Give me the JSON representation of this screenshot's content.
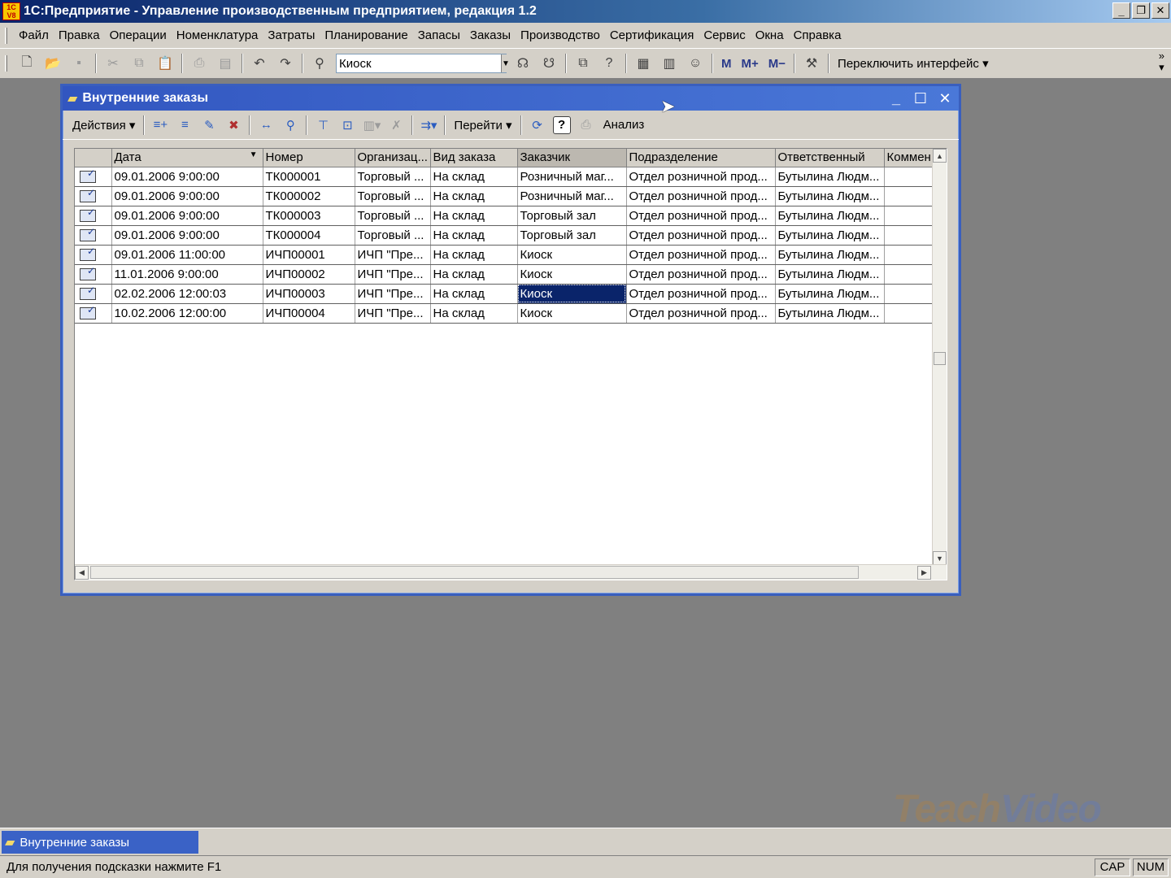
{
  "app": {
    "title": "1С:Предприятие - Управление производственным предприятием, редакция 1.2",
    "logo": "1С V8"
  },
  "menu": [
    "Файл",
    "Правка",
    "Операции",
    "Номенклатура",
    "Затраты",
    "Планирование",
    "Запасы",
    "Заказы",
    "Производство",
    "Сертификация",
    "Сервис",
    "Окна",
    "Справка"
  ],
  "toolbar": {
    "search_value": "Киоск",
    "switch_interface": "Переключить интерфейс ▾",
    "m": "M",
    "m_plus": "M+",
    "m_minus": "M−"
  },
  "child_window": {
    "title": "Внутренние заказы",
    "actions_label": "Действия ▾",
    "goto_label": "Перейти ▾",
    "analysis_label": "Анализ"
  },
  "grid": {
    "columns": [
      "",
      "Дата",
      "Номер",
      "Организац...",
      "Вид заказа",
      "Заказчик",
      "Подразделение",
      "Ответственный",
      "Коммен"
    ],
    "rows": [
      {
        "date": "09.01.2006 9:00:00",
        "number": "ТК000001",
        "org": "Торговый ...",
        "type": "На склад",
        "customer": "Розничный маг...",
        "dept": "Отдел розничной прод...",
        "resp": "Бутылина Людм..."
      },
      {
        "date": "09.01.2006 9:00:00",
        "number": "ТК000002",
        "org": "Торговый ...",
        "type": "На склад",
        "customer": "Розничный маг...",
        "dept": "Отдел розничной прод...",
        "resp": "Бутылина Людм..."
      },
      {
        "date": "09.01.2006 9:00:00",
        "number": "ТК000003",
        "org": "Торговый ...",
        "type": "На склад",
        "customer": "Торговый зал",
        "dept": "Отдел розничной прод...",
        "resp": "Бутылина Людм..."
      },
      {
        "date": "09.01.2006 9:00:00",
        "number": "ТК000004",
        "org": "Торговый ...",
        "type": "На склад",
        "customer": "Торговый зал",
        "dept": "Отдел розничной прод...",
        "resp": "Бутылина Людм..."
      },
      {
        "date": "09.01.2006 11:00:00",
        "number": "ИЧП00001",
        "org": "ИЧП \"Пре...",
        "type": "На склад",
        "customer": "Киоск",
        "dept": "Отдел розничной прод...",
        "resp": "Бутылина Людм..."
      },
      {
        "date": "11.01.2006 9:00:00",
        "number": "ИЧП00002",
        "org": "ИЧП \"Пре...",
        "type": "На склад",
        "customer": "Киоск",
        "dept": "Отдел розничной прод...",
        "resp": "Бутылина Людм..."
      },
      {
        "date": "02.02.2006 12:00:03",
        "number": "ИЧП00003",
        "org": "ИЧП \"Пре...",
        "type": "На склад",
        "customer": "Киоск",
        "dept": "Отдел розничной прод...",
        "resp": "Бутылина Людм..."
      },
      {
        "date": "10.02.2006 12:00:00",
        "number": "ИЧП00004",
        "org": "ИЧП \"Пре...",
        "type": "На склад",
        "customer": "Киоск",
        "dept": "Отдел розничной прод...",
        "resp": "Бутылина Людм..."
      }
    ],
    "selected_row": 6,
    "selected_column": "customer"
  },
  "watermark": {
    "part1": "Teach",
    "part2": "Video"
  },
  "window_list": {
    "item": "Внутренние заказы"
  },
  "status": {
    "hint": "Для получения подсказки нажмите F1",
    "cap": "CAP",
    "num": "NUM"
  },
  "colors": {
    "selection": "#0a246a",
    "child_title": "#3c64c8",
    "desktop": "#808080"
  }
}
